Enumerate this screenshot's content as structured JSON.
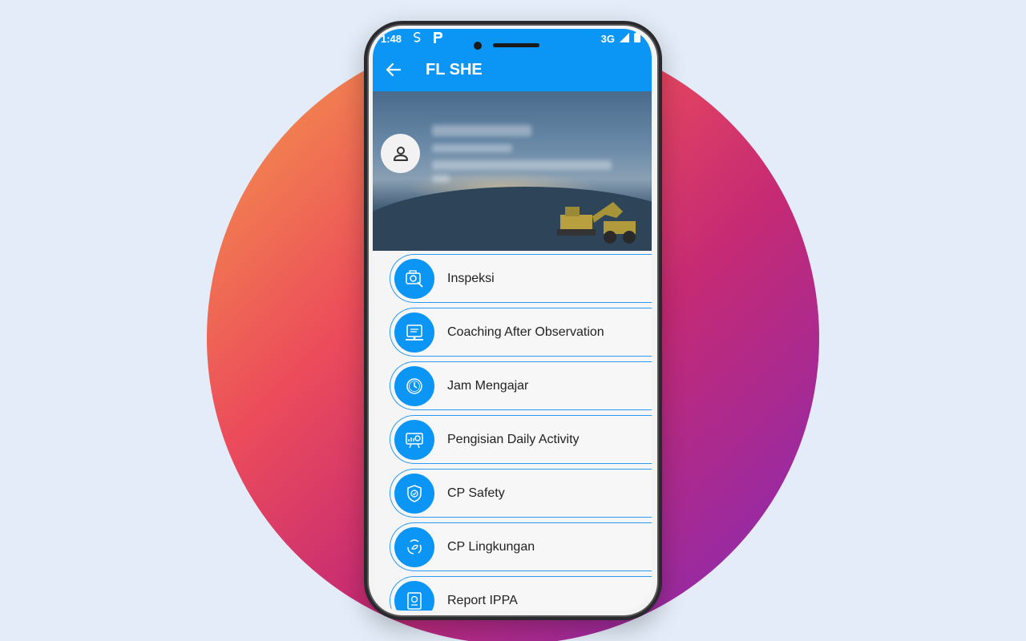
{
  "status_bar": {
    "time": "1:48",
    "network": "3G"
  },
  "app_bar": {
    "title": "FL SHE"
  },
  "menu": [
    {
      "label": "Inspeksi",
      "icon": "inspection-icon"
    },
    {
      "label": "Coaching After Observation",
      "icon": "coaching-icon"
    },
    {
      "label": "Jam Mengajar",
      "icon": "clock-icon"
    },
    {
      "label": "Pengisian Daily Activity",
      "icon": "daily-activity-icon"
    },
    {
      "label": "CP Safety",
      "icon": "shield-icon"
    },
    {
      "label": "CP Lingkungan",
      "icon": "environment-icon"
    },
    {
      "label": "Report IPPA",
      "icon": "report-icon"
    }
  ],
  "colors": {
    "primary": "#0b95f5",
    "background": "#e3ecf8"
  }
}
